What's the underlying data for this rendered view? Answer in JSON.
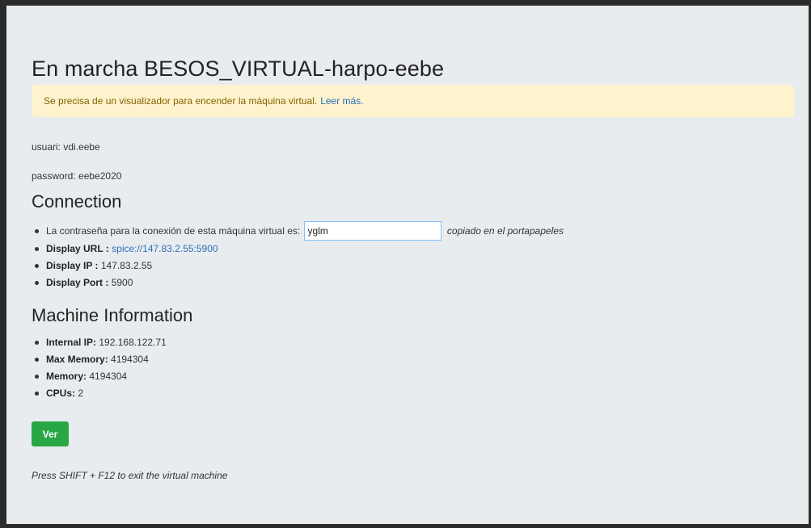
{
  "page": {
    "title": "En marcha BESOS_VIRTUAL-harpo-eebe"
  },
  "alert": {
    "message": "Se precisa de un visualizador para encender la máquina virtual.",
    "link_label": "Leer más."
  },
  "credentials": {
    "user_text": "usuari: vdi.eebe",
    "password_text": "password: eebe2020"
  },
  "connection": {
    "heading": "Connection",
    "password_label": "La contraseña para la conexión de esta máquina virtual es:",
    "password_value": "yglm",
    "copied_note": "copiado en el portapapeles",
    "display_url_label": "Display URL :",
    "display_url_value": "spice://147.83.2.55:5900",
    "display_ip_label": "Display IP :",
    "display_ip_value": "147.83.2.55",
    "display_port_label": "Display Port :",
    "display_port_value": "5900"
  },
  "machine": {
    "heading": "Machine Information",
    "items": [
      {
        "label": "Internal IP:",
        "value": "192.168.122.71"
      },
      {
        "label": "Max Memory:",
        "value": "4194304"
      },
      {
        "label": "Memory:",
        "value": "4194304"
      },
      {
        "label": "CPUs:",
        "value": "2"
      }
    ]
  },
  "actions": {
    "view_button": "Ver"
  },
  "footer": {
    "hint": "Press SHIFT + F12 to exit the virtual machine"
  },
  "colors": {
    "background": "#e9ecef",
    "alert_bg": "#fff3cd",
    "link": "#2a6fba",
    "button": "#28a745"
  }
}
